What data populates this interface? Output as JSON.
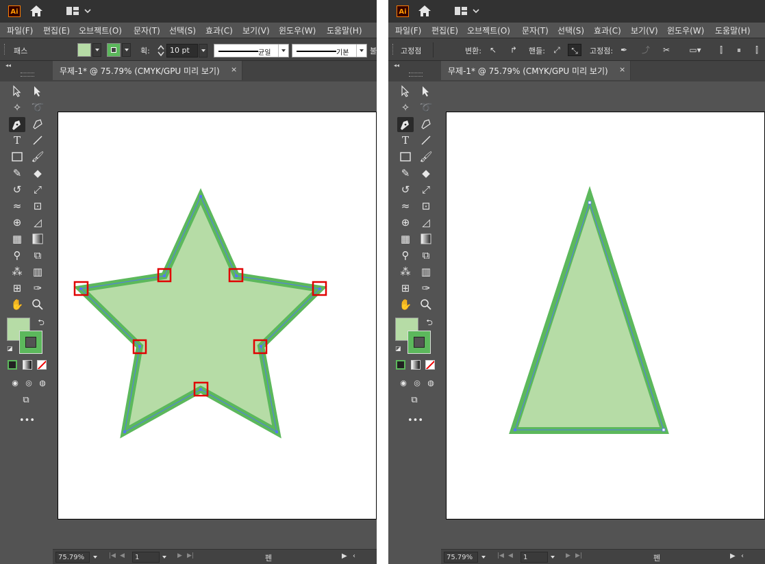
{
  "app": {
    "logo_text": "Ai"
  },
  "menu": [
    "파일(F)",
    "편집(E)",
    "오브젝트(O)",
    "문자(T)",
    "선택(S)",
    "효과(C)",
    "보기(V)",
    "윈도우(W)",
    "도움말(H)"
  ],
  "document": {
    "tab_title": "무제-1* @ 75.79% (CMYK/GPU 미리 보기)",
    "close_glyph": "×"
  },
  "left_window": {
    "control_label": "패스",
    "stroke_label": "획:",
    "stroke_weight": "10 pt",
    "profile_uniform": "균일",
    "profile_basic": "기본",
    "extra": "불"
  },
  "right_window": {
    "control_label": "고정점",
    "convert_label": "변환:",
    "handles_label": "핸들:",
    "anchor_label": "고정점:"
  },
  "status": {
    "zoom": "75.79%",
    "page": "1",
    "mode": "펜"
  },
  "colors": {
    "fill": "#b6dca6",
    "stroke": "#5cb85c",
    "path": "#5577ee",
    "highlight": "#e00000",
    "accent": "#ff9a00"
  },
  "icons": {
    "home": "home-icon",
    "workspace": "workspace-icon",
    "selection": "selection-icon",
    "pen": "pen-icon"
  }
}
